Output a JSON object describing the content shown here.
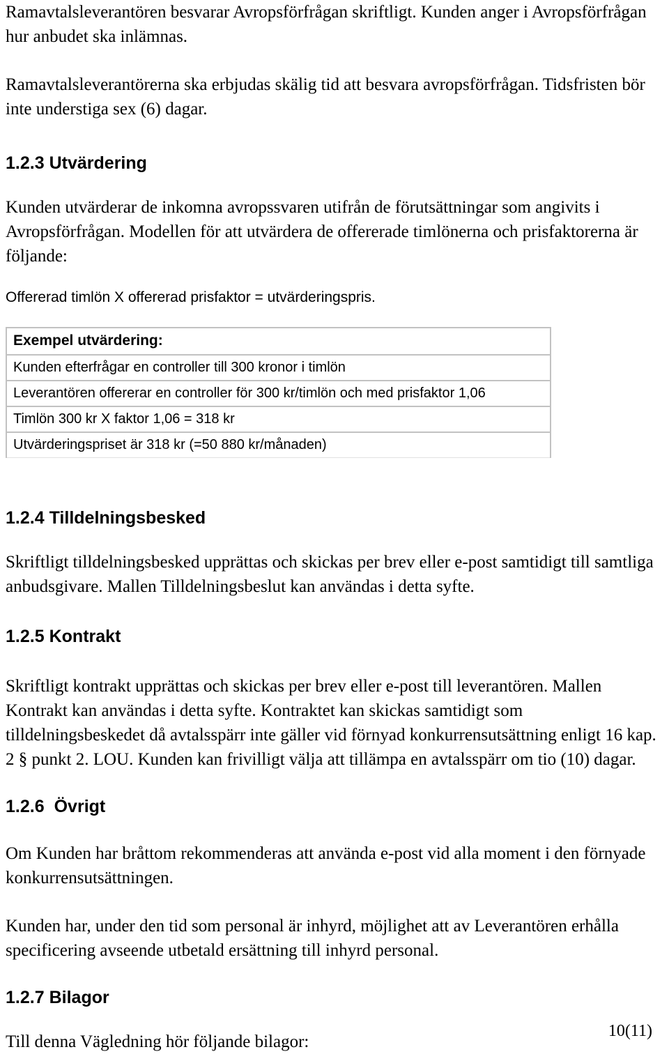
{
  "document": {
    "page_label": "10(11)",
    "intro_paragraphs": [
      "Ramavtalsleverantören besvarar Avropsförfrågan skriftligt. Kunden anger i Avropsförfrågan hur anbudet ska inlämnas.",
      "Ramavtalsleverantörerna ska erbjudas skälig tid att besvara avropsförfrågan. Tidsfristen bör inte understiga sex (6) dagar."
    ],
    "sections": [
      {
        "number": "1.2.3",
        "title": "Utvärdering",
        "paragraphs": [
          "Kunden utvärderar de inkomna avropssvaren utifrån de förutsättningar som angivits i Avropsförfrågan. Modellen för att utvärdera de offererade timlönerna och prisfaktorerna är följande:"
        ],
        "formula": "Offererad timlön X offererad prisfaktor = utvärderingspris."
      },
      {
        "number": "1.2.4",
        "title": "Tilldelningsbesked",
        "paragraphs": [
          "Skriftligt tilldelningsbesked upprättas och skickas per brev eller e-post samtidigt till samtliga anbudsgivare. Mallen Tilldelningsbeslut kan användas i detta syfte."
        ]
      },
      {
        "number": "1.2.5",
        "title": "Kontrakt",
        "paragraphs": [
          "Skriftligt kontrakt upprättas och skickas per brev eller e-post till leverantören. Mallen Kontrakt kan användas i detta syfte. Kontraktet kan skickas samtidigt som tilldelningsbeskedet då avtalsspärr inte gäller vid förnyad konkurrensutsättning enligt 16 kap. 2 § punkt 2. LOU. Kunden kan frivilligt välja att tillämpa en avtalsspärr om tio (10) dagar."
        ]
      },
      {
        "number": "1.2.6",
        "title": "Övrigt",
        "paragraphs": [
          "Om Kunden har bråttom rekommenderas att använda e-post vid alla moment i den förnyade konkurrensutsättningen.",
          "Kunden har, under den tid som personal är inhyrd, möjlighet att av Leverantören erhålla specificering avseende utbetald ersättning till inhyrd personal."
        ]
      },
      {
        "number": "1.2.7",
        "title": "Bilagor",
        "paragraphs": [
          "Till denna Vägledning hör följande bilagor:"
        ]
      }
    ],
    "example_table": {
      "header": "Exempel utvärdering:",
      "rows": [
        "Kunden efterfrågar en controller till 300 kronor i timlön",
        "Leverantören offererar en controller för 300 kr/timlön och med prisfaktor 1,06",
        "Timlön 300 kr X faktor 1,06 = 318 kr",
        "Utvärderingspriset är 318 kr (=50 880 kr/månaden)"
      ]
    }
  }
}
